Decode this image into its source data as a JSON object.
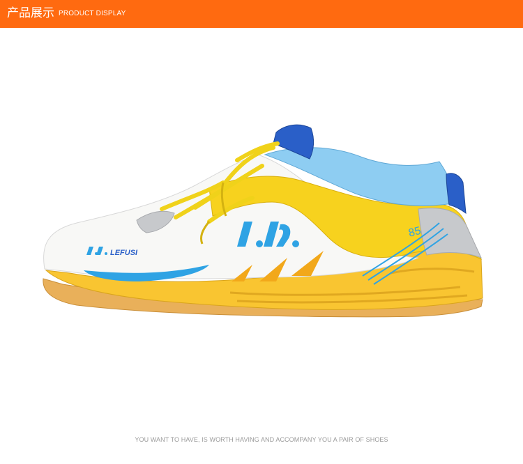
{
  "header": {
    "title_cn": "产品展示",
    "title_en": "PRODUCT DISPLAY"
  },
  "product": {
    "brand_logo_text": "LEFUSI",
    "model_number": "85",
    "colors": {
      "header_bar": "#ff6a10",
      "upper_white": "#f8f8f6",
      "accent_yellow": "#f7d21e",
      "sole_yellow": "#f9c531",
      "gum_outsole": "#e9b05a",
      "light_blue": "#8ecdf2",
      "royal_blue": "#2a5fc8",
      "silver": "#c7c9cc",
      "logo_blue": "#2fa3e4"
    }
  },
  "footer": {
    "caption": "YOU WANT TO HAVE, IS WORTH HAVING AND ACCOMPANY YOU A PAIR OF SHOES"
  }
}
